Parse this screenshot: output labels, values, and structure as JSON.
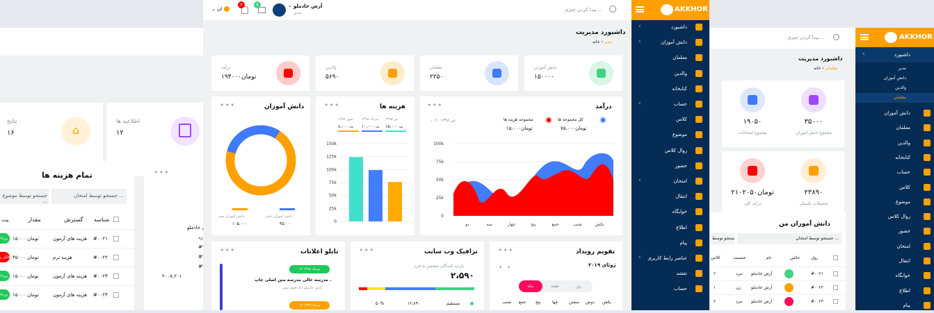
{
  "left_shot": {
    "card_sections": {
      "label": "اطلاعیه ها",
      "value": "۱۲"
    },
    "card_results": {
      "label": "نتایج",
      "value": "۱۶"
    },
    "expenses_title": "تمام هزینه ها",
    "search_name": "جستجو توسط امتحان ...",
    "search_type": "جستجو توسط موضوع ...",
    "table_headers": [
      "شناسه",
      "گسترش",
      "مقدار",
      "وضعیت"
    ],
    "rows": [
      {
        "id": "#۰۰۲۱",
        "name": "هزینه های آزمون",
        "amount": "۱۵۰۰۰ تومان",
        "status": "پرداخت",
        "color": "#1ec95a"
      },
      {
        "id": "#۰۰۲۲",
        "name": "هزینه ترم",
        "amount": "۳۵۰۰۰ تومان",
        "status": "قابل پرداخت",
        "color": "#ff0000"
      },
      {
        "id": "#۰۰۲۳",
        "name": "هزینه های آزمون",
        "amount": "۱۵۰۰۰ تومان",
        "status": "پرداخت",
        "color": "#1ec95a"
      },
      {
        "id": "#۰۰۲۴",
        "name": "هزینه های آزمون",
        "amount": "۱۵۰۰۰ تومان",
        "status": "پرداخت",
        "color": "#1ec95a"
      }
    ],
    "notice_snippet": [
      "ارش خادملو",
      "رد",
      "#۲۲۲",
      "#۲۲۲",
      "#۲۲۲",
      "۲۰۰۸.۲۰۱"
    ]
  },
  "center": {
    "header": {
      "user_name": "آرش خادملو",
      "user_role": "مدیر",
      "lang": "ان",
      "badge_alert": "۸",
      "badge_mail": "۵",
      "search_placeholder": "پیدا کردن چیزی ..."
    },
    "page_title": "داشبورد مدیریت",
    "breadcrumb": {
      "home": "خانه",
      "current": "مدیر"
    },
    "stats": [
      {
        "label": "دانش آموزان",
        "value": "۱۵۰۰۰۰",
        "color": "#3fd382"
      },
      {
        "label": "معلمان",
        "value": "۲۲۵۰",
        "color": "#3f7afc"
      },
      {
        "label": "والدین",
        "value": "۵۶۹۰",
        "color": "#ffa001"
      },
      {
        "label": "درآمد",
        "value": "تومان۱۹۳۰۰۰",
        "color": "#ff0000"
      }
    ],
    "earnings": {
      "title": "درآمد",
      "legend": [
        {
          "label": "کل مجموعه ها",
          "value": "۷۵،۰۰۰تومان",
          "color": "#3f7afc"
        },
        {
          "label": "مجموعه هزینه ها",
          "value": "۱۵،۰۰۰تومان",
          "color": "#ff0000"
        }
      ],
      "date_select": "۲۰ تیر ۱۳۹۸",
      "y_ticks": [
        "100k",
        "75k",
        "50k",
        "25k",
        "0"
      ],
      "x_labels": [
        "یکش",
        "شنب",
        "جمع",
        "پنج",
        "چهار",
        "سه",
        "دو"
      ]
    },
    "expenses": {
      "title": "هزینه ها",
      "legend": [
        {
          "label": "تیر ۱۳۹۸",
          "value": "۱۵،۰۰۰ ت",
          "color": "#40dfcd"
        },
        {
          "label": "مرداد ۱۳۹۸",
          "value": "۱۰،۰۰۰ ت",
          "color": "#417dfc"
        },
        {
          "label": "شهر ۱۳۹۸",
          "value": "۸،۰۰۰ ت",
          "color": "#ffaa01"
        }
      ],
      "y_ticks": [
        "150k",
        "125k",
        "100k",
        "75k",
        "50k",
        "25k",
        "0"
      ]
    },
    "students": {
      "title": "دانش آموزان",
      "legend": [
        {
          "label": "دانش آموزان دختر",
          "value": "۴۵،۰۰۰",
          "color": "#3f7afc"
        },
        {
          "label": "دانش آموزان پسر",
          "value": "۱۰۵،۰۰۰",
          "color": "#ffa001"
        }
      ]
    },
    "calendar": {
      "title": "تقویم رویداد",
      "month": "ژوئای ۲۰۱۹",
      "tabs": [
        "روز",
        "هفته",
        "ماه"
      ],
      "days": [
        "یکش",
        "دوش",
        "سشن",
        "چها",
        "پنج",
        "جمع",
        "شنب"
      ]
    },
    "traffic": {
      "title": "ترافیک وب سایت",
      "subtitle": "بازدید کنندگان منحصر به فرد",
      "value": "۲،۵۹۰",
      "row": {
        "label": "مستقیم",
        "count": "۱۲،۸۹۰",
        "pct": "۵۰%"
      }
    },
    "notices": {
      "title": "تابلو اعلانات",
      "items": [
        {
          "date": "۱۶ مرداد ۱۳۹۸",
          "title": "مدرسه عالی مدرسه متن اصلی چاپ .",
          "meta": "آرش خادملو / ۵ دقیقه پیش",
          "color": "#1ec95a"
        },
        {
          "date": "۱۶ مرداد ۱۳۹۸",
          "color": "#ffa001"
        }
      ]
    }
  },
  "mid_sidebar": {
    "logo": "AKKHOR",
    "items": [
      "داشبورد",
      "دانش آموزان",
      "معلمان",
      "والدین",
      "کتابخانه",
      "حساب",
      "کلاس",
      "موضوع",
      "روال کلاس",
      "حضور",
      "امتحان",
      "انتقال",
      "خوابگاه",
      "اطلاع",
      "پیام",
      "عناصر رابط کاربری",
      "نقشه",
      "حساب"
    ]
  },
  "right": {
    "search_placeholder": "پیدا کردن چیزی ...",
    "page_title": "داشبورد مدیریت",
    "breadcrumb": {
      "home": "خانه",
      "current": "معلمان"
    },
    "stats": [
      {
        "label": "مجموع دانش آموزان",
        "value": "۳۵۰۰۰",
        "color": "#a046ff"
      },
      {
        "label": "مجموع امتحانات",
        "value": "۱۹۰۵۰",
        "color": "#3f7afc"
      },
      {
        "label": "تحصیلات تکمیلی",
        "value": "۲۳۸۹۰",
        "color": "#ffa001"
      },
      {
        "label": "درآمد کلی",
        "value": "تومان۲۱۰۲۰۵۰",
        "color": "#ff0000"
      }
    ],
    "table_title": "دانش آموزان من",
    "table_search": "جستجو توسط امتحان ...",
    "table_search2": "جستجو توسط ...",
    "headers": [
      "رول",
      "عکس",
      "نام",
      "جنسیت",
      "کلاس"
    ],
    "rows": [
      {
        "id": "#۰۰۲۱",
        "name": "آرش خادملو",
        "gender": "مرد",
        "cls": "۲"
      },
      {
        "id": "#۰۰۲۲",
        "name": "آرش خادملو",
        "gender": "زن",
        "cls": "۱"
      },
      {
        "id": "#۰۰۲۳",
        "name": "آرش خادملو",
        "gender": "مرد",
        "cls": "۲"
      }
    ]
  },
  "right_sidebar": {
    "logo": "AKKHOR",
    "dashboard": "داشبورد",
    "sub": [
      "مدیر",
      "دانش آموزان",
      "والدین",
      "معلمان"
    ],
    "items": [
      "دانش آموزان",
      "معلمان",
      "والدین",
      "کتابخانه",
      "حساب",
      "کلاس",
      "موضوع",
      "روال کلاس",
      "حضور",
      "امتحان",
      "انتقال",
      "خوابگاه",
      "اطلاع",
      "پیام"
    ]
  }
}
